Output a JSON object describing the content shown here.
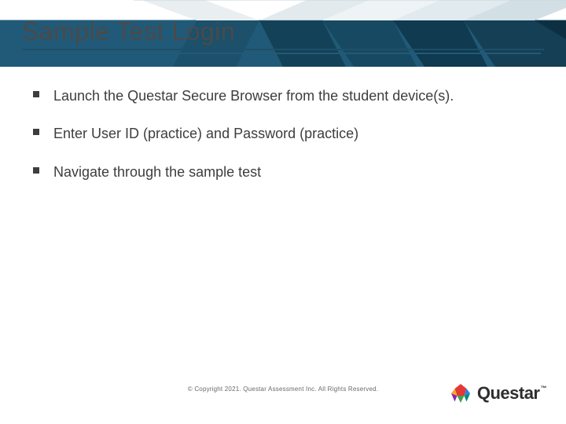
{
  "title": "Sample Test Login",
  "bullets": [
    "Launch the Questar Secure Browser from the student device(s).",
    "Enter User ID (practice) and Password (practice)",
    "Navigate through the sample test"
  ],
  "copyright": "© Copyright 2021.  Questar Assessment Inc.  All Rights Reserved.",
  "logo_text": "Questar",
  "logo_tm": "™"
}
